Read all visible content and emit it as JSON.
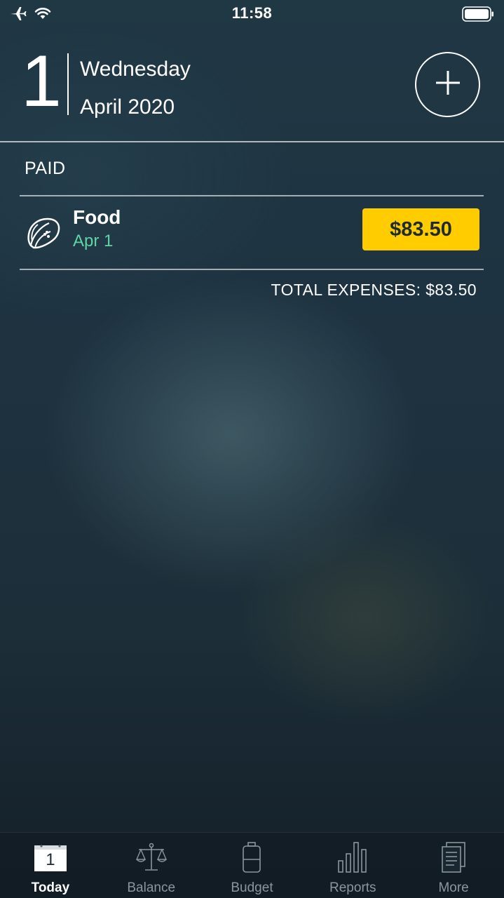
{
  "status_bar": {
    "time": "11:58",
    "icons": [
      "airplane-icon",
      "wifi-icon",
      "battery-icon"
    ]
  },
  "header": {
    "day": "1",
    "weekday": "Wednesday",
    "month_year": "April 2020",
    "add_icon": "plus-icon"
  },
  "section": {
    "label": "PAID"
  },
  "expenses": [
    {
      "category": "Food",
      "date": "Apr 1",
      "amount": "$83.50",
      "icon": "taco-icon"
    }
  ],
  "total": "TOTAL EXPENSES: $83.50",
  "tabs": [
    {
      "label": "Today",
      "icon": "calendar-icon",
      "calendar_day": "1",
      "active": true
    },
    {
      "label": "Balance",
      "icon": "scale-icon",
      "active": false
    },
    {
      "label": "Budget",
      "icon": "battery-budget-icon",
      "active": false
    },
    {
      "label": "Reports",
      "icon": "bar-chart-icon",
      "active": false
    },
    {
      "label": "More",
      "icon": "documents-icon",
      "active": false
    }
  ],
  "colors": {
    "accent_amount": "#ffcc00",
    "date_green": "#5fd4a4",
    "inactive_tab": "#8a969d"
  }
}
